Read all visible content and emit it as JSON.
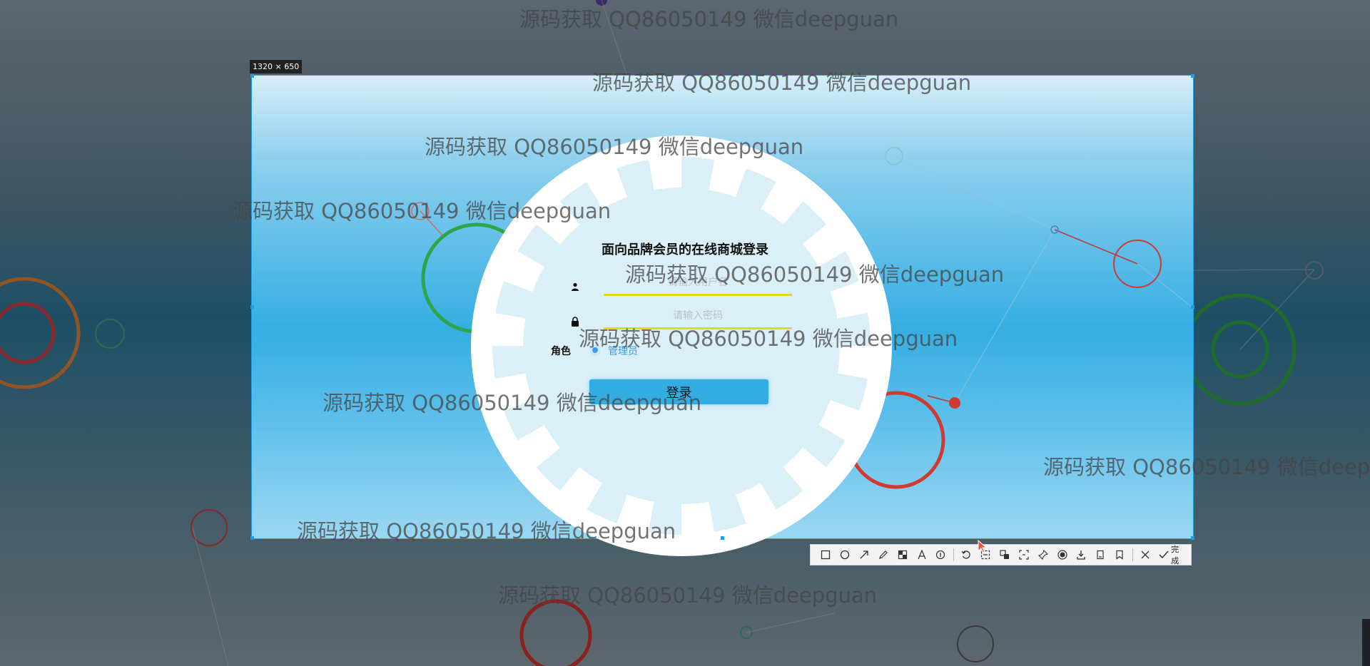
{
  "selection": {
    "size_label": "1320 × 650"
  },
  "login": {
    "title": "面向品牌会员的在线商城登录",
    "username_placeholder": "请输入用户名",
    "password_placeholder": "请输入密码",
    "role_label": "角色",
    "role_option": "管理员",
    "login_button": "登录"
  },
  "toolbar": {
    "items": [
      "rectangle-icon",
      "ellipse-icon",
      "arrow-icon",
      "pen-icon",
      "mosaic-icon",
      "text-icon",
      "number-icon",
      "undo-icon",
      "ocr-icon",
      "translate-icon",
      "scroll-capture-icon",
      "pin-icon",
      "record-icon",
      "download-icon",
      "save-icon",
      "bookmark-icon",
      "close-icon"
    ],
    "done_label": "完成"
  },
  "watermark": {
    "text": "源码获取 QQ86050149 微信deepguan"
  },
  "colors": {
    "accent": "#33ace2",
    "underline": "#f1d21a",
    "selection_border": "#1aa0e8"
  }
}
